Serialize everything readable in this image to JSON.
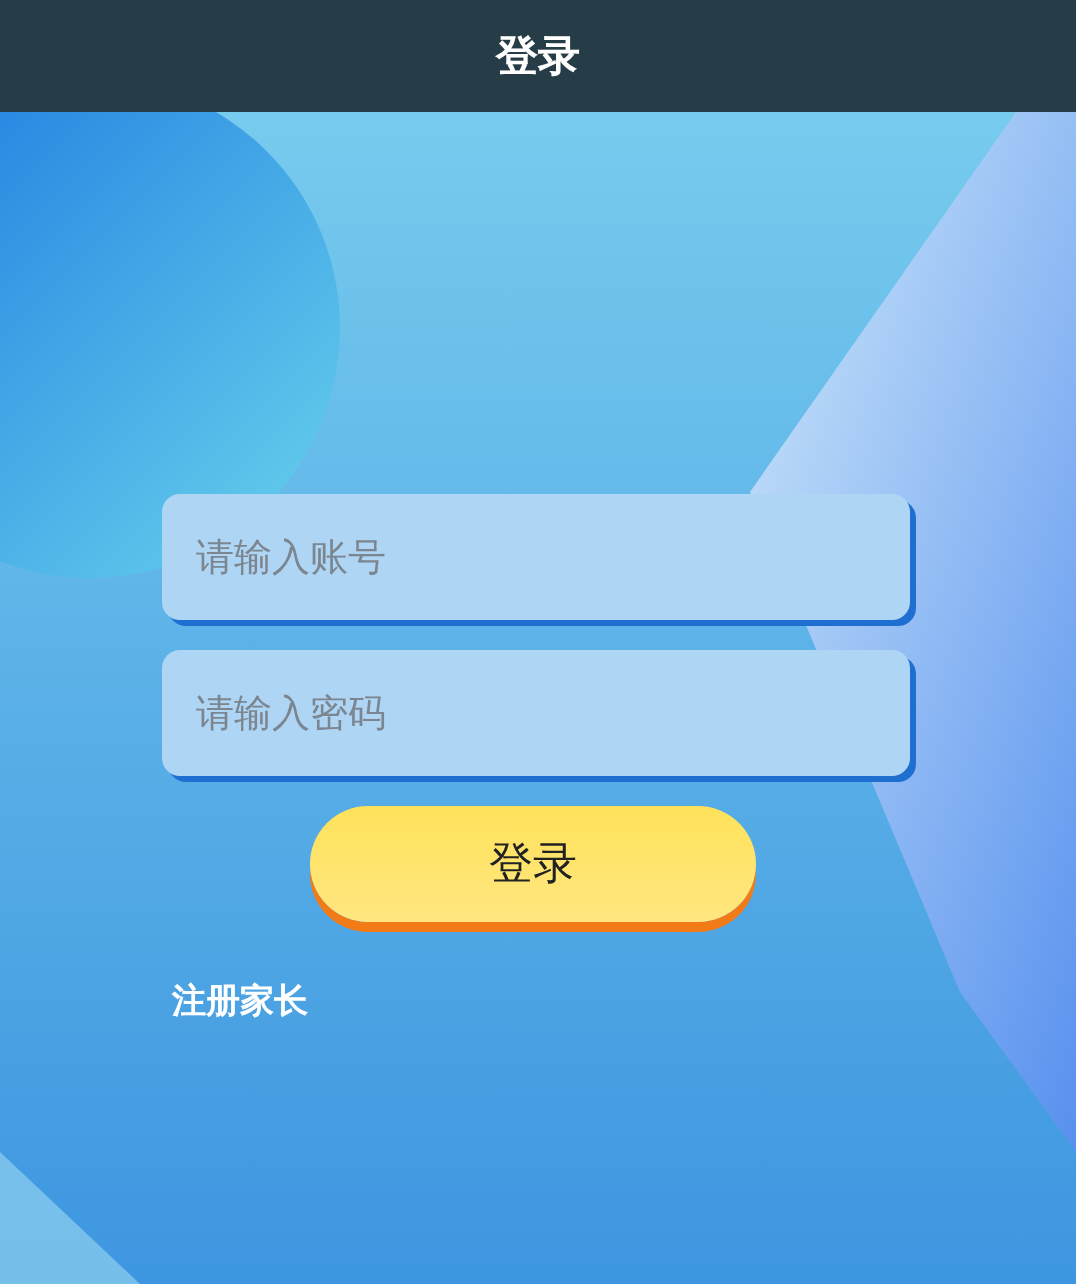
{
  "header": {
    "title": "登录"
  },
  "fields": [
    {
      "placeholder": "请输入账号"
    },
    {
      "placeholder": "请输入密码"
    }
  ],
  "login_button": {
    "label": "登录"
  },
  "register_link": {
    "label": "注册家长"
  }
}
